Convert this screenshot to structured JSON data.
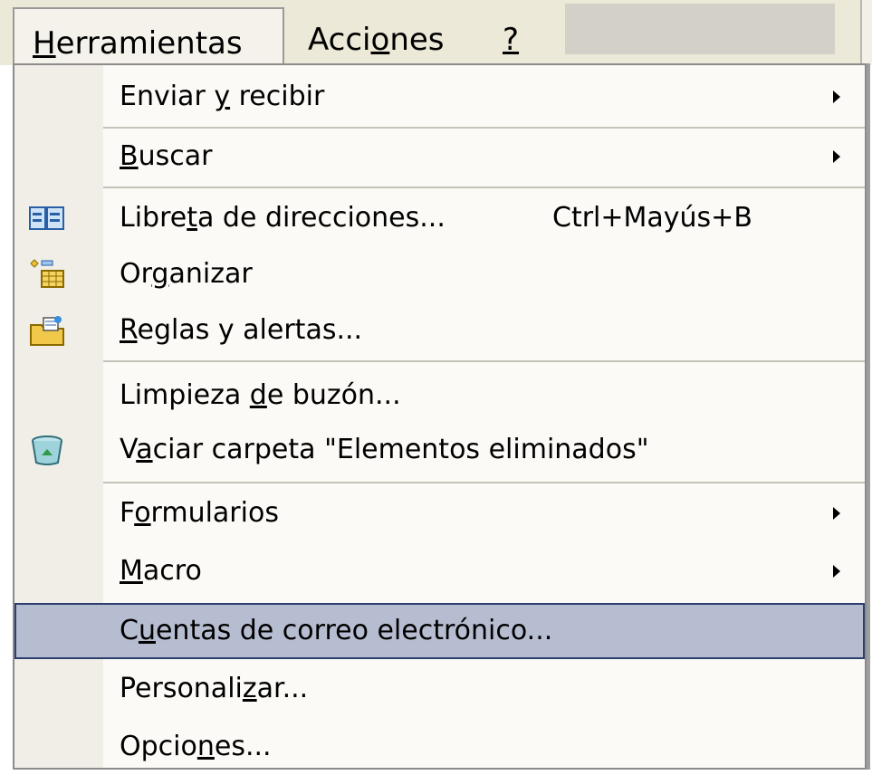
{
  "menubar": {
    "items": [
      {
        "label_pre": "",
        "label_acc": "H",
        "label_post": "erramientas"
      },
      {
        "label_pre": "Acci",
        "label_acc": "o",
        "label_post": "nes"
      },
      {
        "label_pre": "",
        "label_acc": "?",
        "label_post": ""
      }
    ]
  },
  "menu": {
    "items": [
      {
        "pre": "Enviar ",
        "acc": "y",
        "post": " recibir",
        "has_submenu": true
      },
      {
        "pre": "",
        "acc": "B",
        "post": "uscar",
        "has_submenu": true
      },
      {
        "pre": "Libre",
        "acc": "t",
        "post": "a de direcciones...",
        "shortcut": "Ctrl+Mayús+B",
        "icon": "address-book-icon"
      },
      {
        "pre": "Or",
        "acc": "g",
        "post": "anizar",
        "icon": "organize-icon"
      },
      {
        "pre": "",
        "acc": "R",
        "post": "eglas y alertas...",
        "icon": "rules-alerts-icon"
      },
      {
        "pre": "Limpieza ",
        "acc": "d",
        "post": "e buzón..."
      },
      {
        "pre": "V",
        "acc": "a",
        "post": "ciar carpeta \"Elementos eliminados\"",
        "icon": "recycle-bin-icon"
      },
      {
        "pre": "F",
        "acc": "o",
        "post": "rmularios",
        "has_submenu": true
      },
      {
        "pre": "",
        "acc": "M",
        "post": "acro",
        "has_submenu": true
      },
      {
        "pre": "C",
        "acc": "u",
        "post": "entas de correo electrónico...",
        "highlighted": true
      },
      {
        "pre": "Personali",
        "acc": "z",
        "post": "ar..."
      },
      {
        "pre": "Opcio",
        "acc": "n",
        "post": "es..."
      }
    ]
  },
  "colors": {
    "menubar_bg": "#ece9d8",
    "menu_bg": "#fbfaf6",
    "gutter_bg": "#f0eee6",
    "highlight_bg": "#b7bdd0",
    "highlight_border": "#2d3f70"
  }
}
